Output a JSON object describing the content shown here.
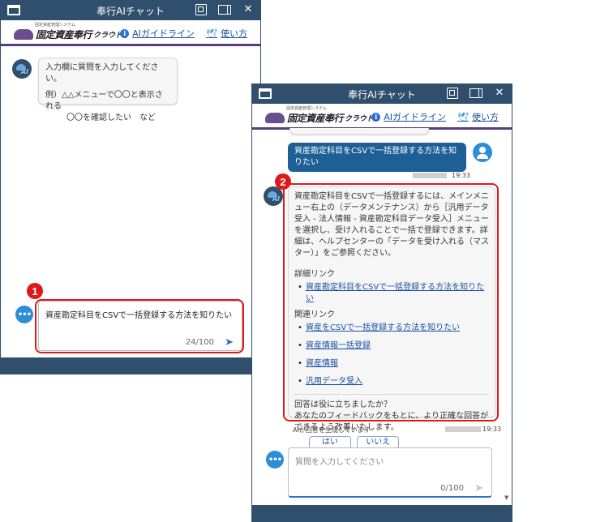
{
  "window_title": "奉行AIチャット",
  "logo": {
    "small": "固定資産管理システム",
    "main": "固定資産奉行",
    "sub": "クラウド"
  },
  "header_links": {
    "guideline": "AIガイドライン",
    "howto": "使い方"
  },
  "left_window": {
    "greeting_line1": "入力欄に質問を入力してください。",
    "greeting_line2": "例）△△メニューで〇〇と表示される",
    "greeting_line3": "〇〇を確認したい　など",
    "input_value": "資産勘定科目をCSVで一括登録する方法を知りたい",
    "counter": "24/100",
    "marker": "1"
  },
  "right_window": {
    "user_message": "資産勘定科目をCSVで一括登録する方法を知りたい",
    "user_time": "19:33",
    "response_text": "資産勘定科目をCSVで一括登録するには、メインメニュー右上の（データメンテナンス）から［汎用データ受入 - 法人情報 - 資産勘定科目データ受入］メニューを選択し、受け入れることで一括で登録できます。詳細は、ヘルプセンターの「データを受け入れる（マスター）」をご参照ください。",
    "details_heading": "詳細リンク",
    "details_links": [
      "資産勘定科目をCSVで一括登録する方法を知りたい"
    ],
    "related_heading": "関連リンク",
    "related_links": [
      "資産をCSVで一括登録する方法を知りたい",
      "資産情報一括登録",
      "資産情報",
      "汎用データ受入"
    ],
    "feedback_q": "回答は役に立ちましたか？",
    "feedback_note": "あなたのフィードバックをもとに、より正確な回答ができるよう改善いたします。",
    "yes": "はい",
    "no": "いいえ",
    "disclaimer": "AIが回答を生成しています",
    "response_time": "19:33",
    "input_placeholder": "質問を入力してください",
    "counter": "0/100",
    "marker": "2"
  },
  "icons": {
    "ai_avatar": "AI",
    "chat": "•••",
    "send": "➤",
    "info": "i",
    "bird": "🕊"
  },
  "colors": {
    "titlebar": "#2f4f6d",
    "accent_red": "#e0181b",
    "user_bubble": "#1e5f96",
    "link": "#1a4fa3"
  }
}
